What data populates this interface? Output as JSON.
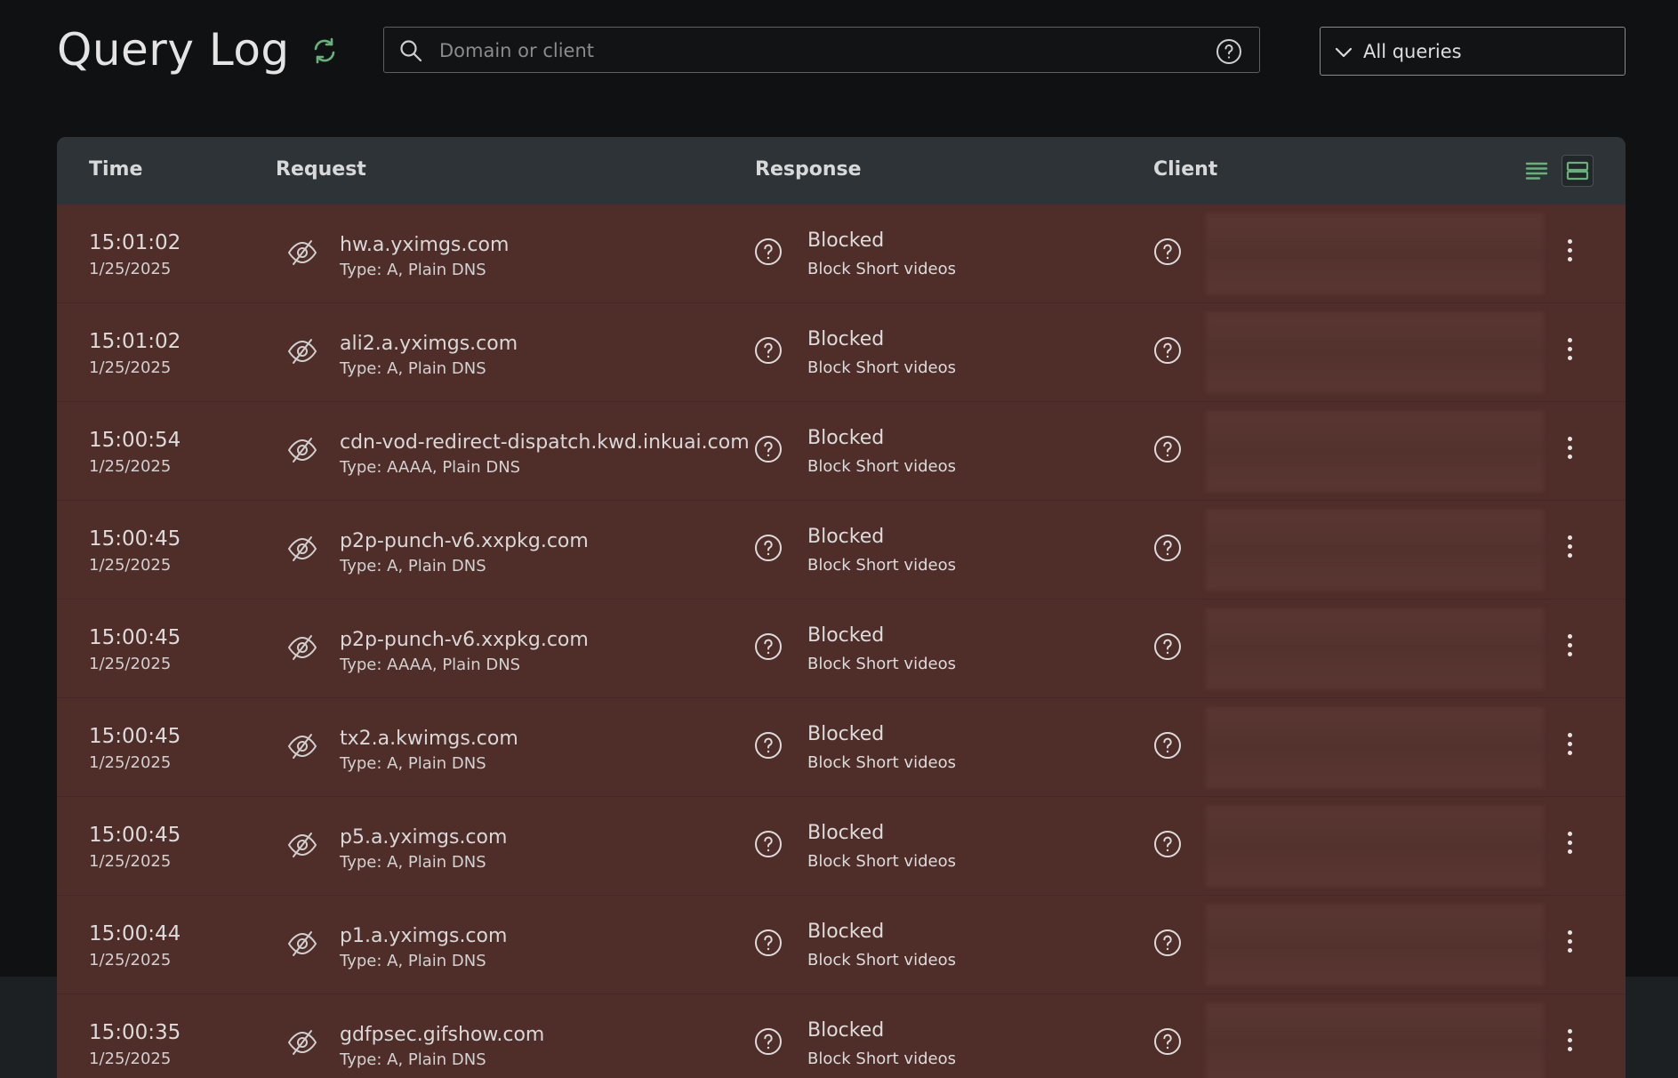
{
  "page": {
    "title": "Query Log"
  },
  "search": {
    "placeholder": "Domain or client",
    "value": ""
  },
  "filter": {
    "selected": "All queries"
  },
  "table": {
    "columns": [
      "Time",
      "Request",
      "Response",
      "Client"
    ],
    "rows": [
      {
        "time": "15:01:02",
        "date": "1/25/2025",
        "domain": "hw.a.yximgs.com",
        "type": "Type: A, Plain DNS",
        "status": "Blocked",
        "rule": "Block Short videos"
      },
      {
        "time": "15:01:02",
        "date": "1/25/2025",
        "domain": "ali2.a.yximgs.com",
        "type": "Type: A, Plain DNS",
        "status": "Blocked",
        "rule": "Block Short videos"
      },
      {
        "time": "15:00:54",
        "date": "1/25/2025",
        "domain": "cdn-vod-redirect-dispatch.kwd.inkuai.com",
        "type": "Type: AAAA, Plain DNS",
        "status": "Blocked",
        "rule": "Block Short videos"
      },
      {
        "time": "15:00:45",
        "date": "1/25/2025",
        "domain": "p2p-punch-v6.xxpkg.com",
        "type": "Type: A, Plain DNS",
        "status": "Blocked",
        "rule": "Block Short videos"
      },
      {
        "time": "15:00:45",
        "date": "1/25/2025",
        "domain": "p2p-punch-v6.xxpkg.com",
        "type": "Type: AAAA, Plain DNS",
        "status": "Blocked",
        "rule": "Block Short videos"
      },
      {
        "time": "15:00:45",
        "date": "1/25/2025",
        "domain": "tx2.a.kwimgs.com",
        "type": "Type: A, Plain DNS",
        "status": "Blocked",
        "rule": "Block Short videos"
      },
      {
        "time": "15:00:45",
        "date": "1/25/2025",
        "domain": "p5.a.yximgs.com",
        "type": "Type: A, Plain DNS",
        "status": "Blocked",
        "rule": "Block Short videos"
      },
      {
        "time": "15:00:44",
        "date": "1/25/2025",
        "domain": "p1.a.yximgs.com",
        "type": "Type: A, Plain DNS",
        "status": "Blocked",
        "rule": "Block Short videos"
      },
      {
        "time": "15:00:35",
        "date": "1/25/2025",
        "domain": "gdfpsec.gifshow.com",
        "type": "Type: A, Plain DNS",
        "status": "Blocked",
        "rule": "Block Short videos"
      }
    ]
  },
  "icons": {
    "refresh": "refresh-icon",
    "search": "search-icon",
    "help": "help-circle-icon",
    "chevron": "chevron-down-icon",
    "compact_view": "lines-view-icon",
    "default_view": "rows-view-icon",
    "hidden": "eye-slash-icon",
    "menu": "kebab-menu-icon"
  },
  "colors": {
    "background": "#0f1113",
    "header_bar": "#2e3337",
    "blocked_row": "#4f2d29",
    "accent_green": "#67b279"
  }
}
